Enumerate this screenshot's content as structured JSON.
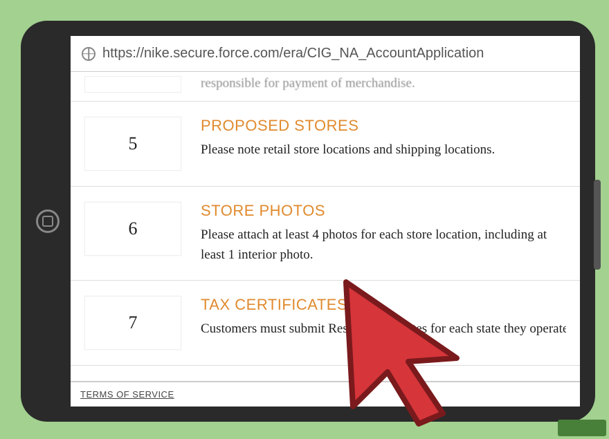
{
  "address_bar": {
    "url": "https://nike.secure.force.com/era/CIG_NA_AccountApplication"
  },
  "partial_row": {
    "text": "responsible for payment of merchandise."
  },
  "steps": [
    {
      "number": "5",
      "title": "PROPOSED STORES",
      "description": "Please note retail store locations and shipping locations."
    },
    {
      "number": "6",
      "title": "STORE PHOTOS",
      "description": "Please attach at least 4 photos for each store location, including at least 1 interior photo."
    },
    {
      "number": "7",
      "title": "TAX CERTIFICATES",
      "description": "Customers must submit Resale Certificates for each state they operate."
    }
  ],
  "footer": {
    "terms": "TERMS OF SERVICE"
  },
  "colors": {
    "background": "#a3d190",
    "accent": "#e08a2e",
    "cursor": "#d6353a"
  }
}
